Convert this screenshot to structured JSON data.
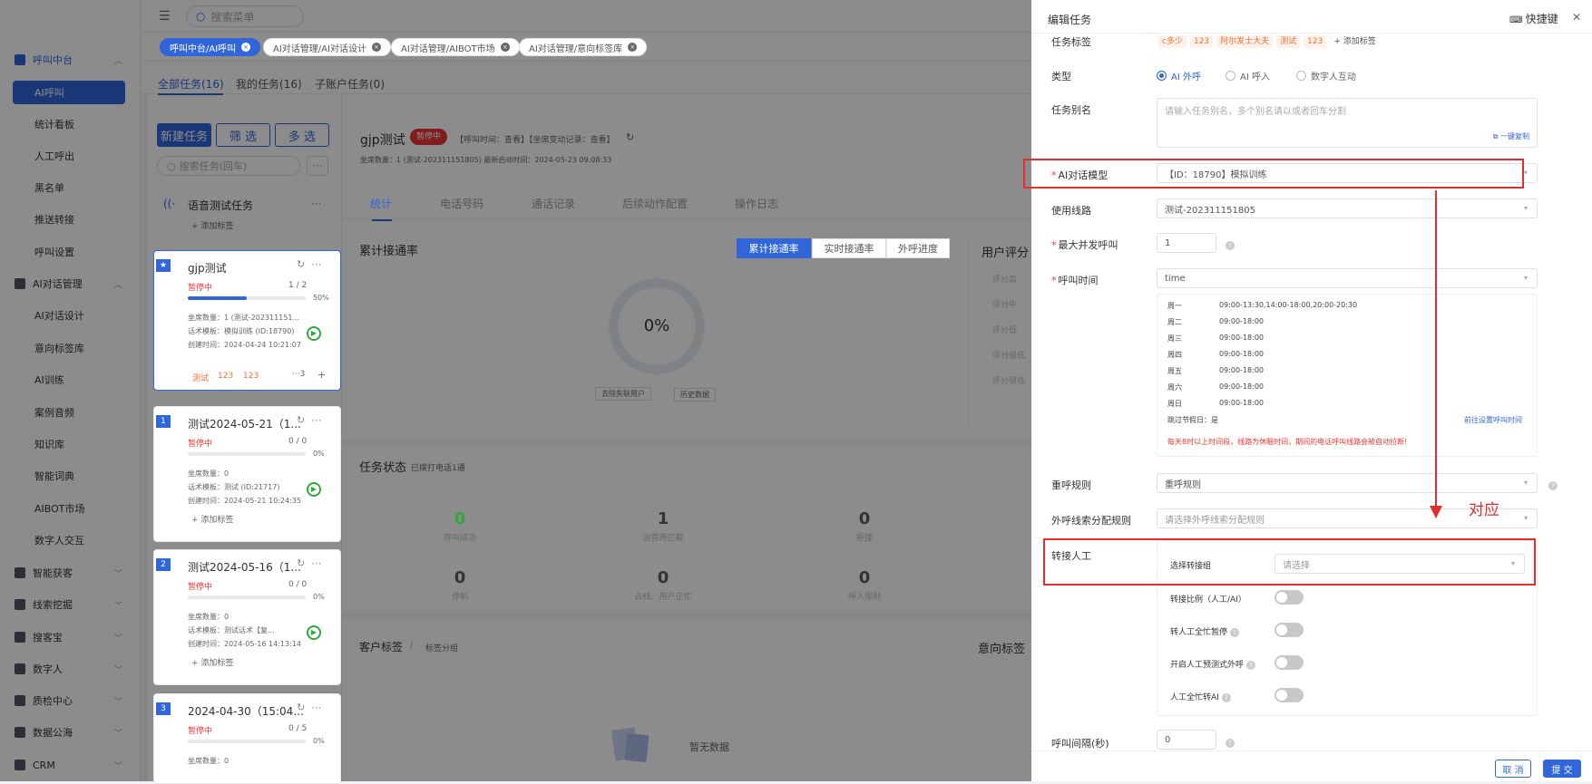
{
  "topbar": {
    "search_placeholder": "搜索菜单"
  },
  "open_tabs": [
    {
      "label": "呼叫中台/AI呼叫",
      "active": true
    },
    {
      "label": "AI对话管理/AI对话设计"
    },
    {
      "label": "AI对话管理/AIBOT市场"
    },
    {
      "label": "AI对话管理/意向标签库"
    }
  ],
  "sidebar": {
    "items": [
      {
        "label": "呼叫中台",
        "type": "group",
        "chev": "^"
      },
      {
        "label": "AI呼叫",
        "type": "active"
      },
      {
        "label": "统计看板"
      },
      {
        "label": "人工呼出"
      },
      {
        "label": "黑名单"
      },
      {
        "label": "推送转接"
      },
      {
        "label": "呼叫设置"
      },
      {
        "label": "AI对话管理",
        "type": "group2",
        "chev": "^"
      },
      {
        "label": "AI对话设计"
      },
      {
        "label": "意向标签库"
      },
      {
        "label": "AI训练"
      },
      {
        "label": "案例音频"
      },
      {
        "label": "知识库"
      },
      {
        "label": "智能词典"
      },
      {
        "label": "AIBOT市场"
      },
      {
        "label": "数字人交互"
      },
      {
        "label": "智能获客",
        "type": "group2",
        "chev": "v"
      },
      {
        "label": "线索挖掘",
        "type": "group2",
        "chev": "v"
      },
      {
        "label": "搜客宝",
        "type": "group2",
        "chev": "v"
      },
      {
        "label": "数字人",
        "type": "group2",
        "chev": "v"
      },
      {
        "label": "质检中心",
        "type": "group2",
        "chev": "v"
      },
      {
        "label": "数据公海",
        "type": "group2",
        "chev": "v"
      },
      {
        "label": "CRM",
        "type": "group2",
        "chev": "v"
      }
    ]
  },
  "main": {
    "subtabs": [
      "全部任务(16)",
      "我的任务(16)",
      "子账户任务(0)"
    ],
    "buttons": {
      "new": "新建任务",
      "filter": "筛 选",
      "multi": "多 选"
    },
    "search_placeholder": "搜索任务(回车)",
    "voice_test": {
      "title": "语音测试任务",
      "add_tag": "+ 添加标签"
    },
    "cards": [
      {
        "badge": "",
        "title": "gjp测试",
        "status": "暂停中",
        "progress": "1 / 2",
        "pct": "50%",
        "fill": 0.5,
        "l1": "坐席数量：1 (测试-202311151...",
        "l2": "话术模板：模拟训练 (ID:18790)",
        "l3": "创建时间：2024-04-24 10:21:07",
        "tags": [
          "测试",
          "123",
          "123"
        ],
        "more": "···3",
        "plus": "+"
      },
      {
        "badge": "1",
        "title": "测试2024-05-21（1...",
        "status": "暂停中",
        "progress": "0 / 0",
        "pct": "0%",
        "fill": 0,
        "l1": "坐席数量：0",
        "l2": "话术模板：测试 (ID:21717)",
        "l3": "创建时间：2024-05-21 10:24:35",
        "add": "+ 添加标签"
      },
      {
        "badge": "2",
        "title": "测试2024-05-16（1...",
        "status": "暂停中",
        "progress": "0 / 0",
        "pct": "0%",
        "fill": 0,
        "l1": "坐席数量：0",
        "l2": "话术模板：测试话术【复...",
        "l3": "创建时间：2024-05-16 14:13:14",
        "add": "+ 添加标签"
      },
      {
        "badge": "3",
        "title": "2024-04-30（15:04...",
        "status": "暂停中",
        "progress": "0 / 5",
        "pct": "0%",
        "fill": 0,
        "l1": "坐席数量：0"
      }
    ],
    "detail": {
      "title": "gjp测试",
      "status": "暂停中",
      "meta": "【呼叫时间：查看】【坐席变动记录：查看】",
      "sub": "坐席数量：1 (测试-202311151805)    最新启动时间：2024-05-23 09:08:33",
      "tabs": [
        "统计",
        "电话号码",
        "通话记录",
        "后续动作配置",
        "操作日志"
      ],
      "rate_title": "累计接通率",
      "rate_btns": [
        "累计接通率",
        "实时接通率",
        "外呼进度"
      ],
      "donut": "0%",
      "filter1": "去除失联用户",
      "filter2": "历史数据",
      "user_score": "用户评分",
      "scores": [
        "评分高",
        "评分中",
        "评分低",
        "评分很低",
        "评分很低"
      ],
      "task_status": "任务状态",
      "task_status_sub": "已拨打电话1通",
      "stats": [
        {
          "n": "0",
          "l": "呼叫成功",
          "green": true
        },
        {
          "n": "1",
          "l": "运营商拦截"
        },
        {
          "n": "0",
          "l": "拒接"
        },
        {
          "n": "0",
          "l": "停机"
        },
        {
          "n": "0",
          "l": "占线、用户正忙"
        },
        {
          "n": "0",
          "l": "呼入限制"
        }
      ],
      "cust_tags": "客户标签",
      "cust_tags_sub": "标签分组",
      "intent_tags": "意向标签",
      "empty": "暂无数据"
    }
  },
  "drawer": {
    "title": "编辑任务",
    "shortcut": "快捷键",
    "close": "✕",
    "task_tag_label": "任务标签",
    "task_tags": [
      "c多少",
      "123",
      "阿尔发士大夫",
      "测试",
      "123"
    ],
    "add_tag": "+ 添加标签",
    "type_label": "类型",
    "types": [
      "AI 外呼",
      "AI 呼入",
      "数字人互动"
    ],
    "alias_label": "任务别名",
    "alias_placeholder": "请输入任务别名，多个别名请以或者回车分割",
    "copy": "一键复制",
    "model_label": "AI对话模型",
    "model_value": "【ID：18790】模拟训练",
    "line_label": "使用线路",
    "line_value": "测试-202311151805",
    "concurrency_label": "最大并发呼叫",
    "concurrency_value": "1",
    "calltime_label": "呼叫时间",
    "calltime_value": "time",
    "schedule": [
      {
        "d": "周一",
        "t": "09:00-13:30,14:00-18:00,20:00-20:30"
      },
      {
        "d": "周二",
        "t": "09:00-18:00"
      },
      {
        "d": "周三",
        "t": "09:00-18:00"
      },
      {
        "d": "周四",
        "t": "09:00-18:00"
      },
      {
        "d": "周五",
        "t": "09:00-18:00"
      },
      {
        "d": "周六",
        "t": "09:00-18:00"
      },
      {
        "d": "周日",
        "t": "09:00-18:00"
      }
    ],
    "skip_holiday": "跳过节假日：是",
    "goto_settings": "前往设置呼叫时间",
    "warning": "每天8时以上时间段，线路为休眠时间，期间的电话呼叫线路会被自动拉断!",
    "redial_label": "重呼规则",
    "redial_value": "重呼规则",
    "assign_label": "外呼线索分配规则",
    "assign_placeholder": "请选择外呼线索分配规则",
    "transfer_label": "转接人工",
    "transfer_group_label": "选择转接组",
    "transfer_group_placeholder": "请选择",
    "toggles": [
      "转接比例（人工/AI）",
      "转人工全忙暂停",
      "开启人工预测式外呼",
      "人工全忙转AI"
    ],
    "interval_label": "呼叫间隔(秒)",
    "interval_value": "0",
    "cancel": "取 消",
    "submit": "提 交",
    "annotation": "对应"
  }
}
